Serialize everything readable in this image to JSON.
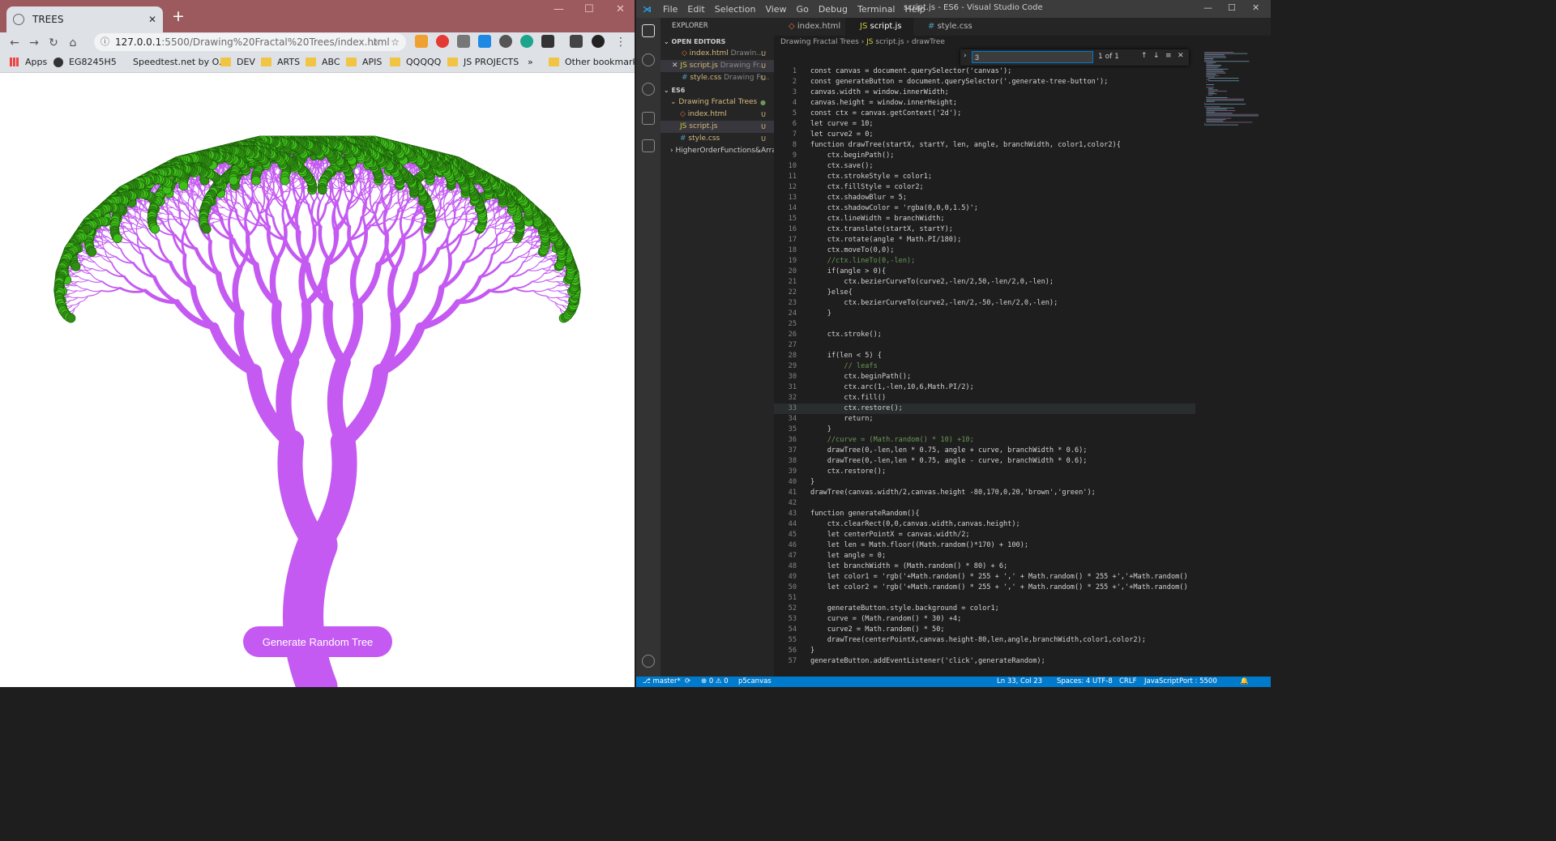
{
  "browser": {
    "tab_title": "TREES",
    "url_host": "127.0.0.1",
    "url_rest": ":5500/Drawing%20Fractal%20Trees/index.html",
    "bookmarks": [
      {
        "label": "Apps",
        "icon": "apps-grid-icon"
      },
      {
        "label": "EG8245H5",
        "icon": "globe-icon"
      },
      {
        "label": "Speedtest.net by O...",
        "icon": "speedtest-icon"
      },
      {
        "label": "DEV",
        "icon": "folder-icon"
      },
      {
        "label": "ARTS",
        "icon": "folder-icon"
      },
      {
        "label": "ABC",
        "icon": "folder-icon"
      },
      {
        "label": "APIS",
        "icon": "folder-icon"
      },
      {
        "label": "QQQQQ",
        "icon": "folder-icon"
      },
      {
        "label": "JS PROJECTS",
        "icon": "folder-icon"
      }
    ],
    "other_bookmarks": "Other bookmarks",
    "generate_button": "Generate Random Tree",
    "colors": {
      "trunk": "#c45af2",
      "leaf": "#3fbf1a",
      "button": "#c45af2"
    }
  },
  "vscode": {
    "window_title": "script.js - ES6 - Visual Studio Code",
    "menu": [
      "File",
      "Edit",
      "Selection",
      "View",
      "Go",
      "Debug",
      "Terminal",
      "Help"
    ],
    "explorer_title": "EXPLORER",
    "open_editors_header": "OPEN EDITORS",
    "open_editors": [
      {
        "name": "index.html",
        "desc": "Drawin...",
        "status": "U"
      },
      {
        "name": "script.js",
        "desc": "Drawing Fr...",
        "status": "U"
      },
      {
        "name": "style.css",
        "desc": "Drawing Fr...",
        "status": "U"
      }
    ],
    "workspace_header": "ES6",
    "folder": "Drawing Fractal Trees",
    "files": [
      {
        "name": "index.html",
        "status": "U"
      },
      {
        "name": "script.js",
        "status": "U"
      },
      {
        "name": "style.css",
        "status": "U"
      }
    ],
    "other_folder": "HigherOrderFunctions&Array",
    "editor_tabs": [
      "index.html",
      "script.js",
      "style.css"
    ],
    "breadcrumb": [
      "Drawing Fractal Trees",
      "script.js",
      "drawTree"
    ],
    "find_value": "3",
    "find_result": "1 of 1",
    "code": [
      "const canvas = document.querySelector('canvas');",
      "const generateButton = document.querySelector('.generate-tree-button');",
      "canvas.width = window.innerWidth;",
      "canvas.height = window.innerHeight;",
      "const ctx = canvas.getContext('2d');",
      "let curve = 10;",
      "let curve2 = 0;",
      "function drawTree(startX, startY, len, angle, branchWidth, color1,color2){",
      "    ctx.beginPath();",
      "    ctx.save();",
      "    ctx.strokeStyle = color1;",
      "    ctx.fillStyle = color2;",
      "    ctx.shadowBlur = 5;",
      "    ctx.shadowColor = 'rgba(0,0,0,1.5)';",
      "    ctx.lineWidth = branchWidth;",
      "    ctx.translate(startX, startY);",
      "    ctx.rotate(angle * Math.PI/180);",
      "    ctx.moveTo(0,0);",
      "    //ctx.lineTo(0,-len);",
      "    if(angle > 0){",
      "        ctx.bezierCurveTo(curve2,-len/2,50,-len/2,0,-len);",
      "    }else{",
      "        ctx.bezierCurveTo(curve2,-len/2,-50,-len/2,0,-len);",
      "    }",
      "",
      "    ctx.stroke();",
      "",
      "    if(len < 5) {",
      "        // leafs",
      "        ctx.beginPath();",
      "        ctx.arc(1,-len,10,6,Math.PI/2);",
      "        ctx.fill()",
      "        ctx.restore();",
      "        return;",
      "    }",
      "    //curve = (Math.random() * 10) +10;",
      "    drawTree(0,-len,len * 0.75, angle + curve, branchWidth * 0.6);",
      "    drawTree(0,-len,len * 0.75, angle - curve, branchWidth * 0.6);",
      "    ctx.restore();",
      "}",
      "drawTree(canvas.width/2,canvas.height -80,170,0,20,'brown','green');",
      "",
      "function generateRandom(){",
      "    ctx.clearRect(0,0,canvas.width,canvas.height);",
      "    let centerPointX = canvas.width/2;",
      "    let len = Math.floor((Math.random()*170) + 100);",
      "    let angle = 0;",
      "    let branchWidth = (Math.random() * 80) + 6;",
      "    let color1 = 'rgb('+Math.random() * 255 + ',' + Math.random() * 255 +','+Math.random()",
      "    let color2 = 'rgb('+Math.random() * 255 + ',' + Math.random() * 255 +','+Math.random()",
      "",
      "    generateButton.style.background = color1;",
      "    curve = (Math.random() * 30) +4;",
      "    curve2 = Math.random() * 50;",
      "    drawTree(centerPointX,canvas.height-80,len,angle,branchWidth,color1,color2);",
      "}",
      "generateButton.addEventListener('click',generateRandom);"
    ],
    "status": {
      "branch": "master*",
      "problems": "⊗ 0 ⚠ 0",
      "project": "p5canvas",
      "position": "Ln 33, Col 23",
      "spaces": "Spaces: 4",
      "encoding": "UTF-8",
      "eol": "CRLF",
      "language": "JavaScript",
      "port": "Port : 5500"
    }
  }
}
